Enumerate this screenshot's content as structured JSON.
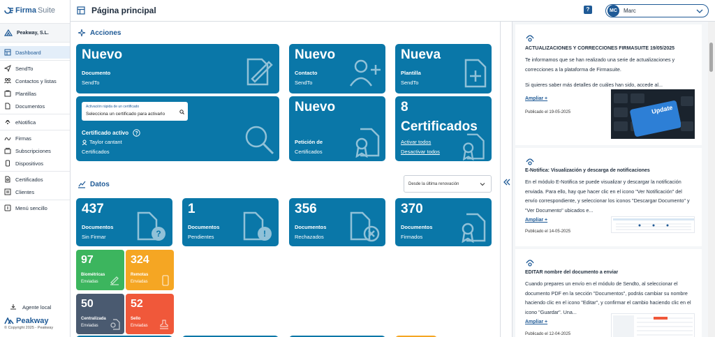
{
  "app": {
    "logo_a": "Firma",
    "logo_b": "Suite"
  },
  "sidebar": {
    "company": "Peakway, S.L.",
    "items": [
      {
        "label": "Dashboard",
        "icon": "dashboard-icon"
      },
      {
        "label": "SendTo",
        "icon": "send-icon"
      },
      {
        "label": "Contactos y listas",
        "icon": "contacts-icon"
      },
      {
        "label": "Plantillas",
        "icon": "templates-icon"
      },
      {
        "label": "Documentos",
        "icon": "documents-icon"
      },
      {
        "label": "eNotifica",
        "icon": "enotifica-icon"
      },
      {
        "label": "Firmas",
        "icon": "signature-icon"
      },
      {
        "label": "Subscripciones",
        "icon": "subscriptions-icon"
      },
      {
        "label": "Dispositivos",
        "icon": "device-icon"
      },
      {
        "label": "Certificados",
        "icon": "certificates-icon"
      },
      {
        "label": "Clientes",
        "icon": "clients-icon"
      },
      {
        "label": "Menú sencillo",
        "icon": "menu-icon"
      }
    ],
    "agent": "Agente local",
    "brand": "Peakway",
    "copyright": "© Copyright 2025 - Peakway"
  },
  "header": {
    "title": "Página principal",
    "help": "?",
    "user_initials": "MC",
    "user_name": "Marc"
  },
  "acciones": {
    "title": "Acciones",
    "cards": [
      {
        "big": "Nuevo",
        "l1": "Documento",
        "l2": "SendTo"
      },
      {
        "big": "Nuevo",
        "l1": "Contacto",
        "l2": "SendTo"
      },
      {
        "big": "Nueva",
        "l1": "Plantilla",
        "l2": "SendTo"
      }
    ],
    "cert": {
      "input_label": "Activación rápida de un certificado",
      "input_placeholder": "Selecciona un certificado para activarlo",
      "l1": "Certificado activo",
      "owner": "Taylor cantant",
      "l2": "Certificados"
    },
    "peticion": {
      "big": "Nuevo",
      "l1": "Petición de",
      "l2": "Certificados"
    },
    "certs": {
      "big1": "8",
      "big2": "Certificados",
      "activate": "Activar todos",
      "deactivate": "Desactivar todos"
    }
  },
  "datos": {
    "title": "Datos",
    "filter": "Desde la última renovación",
    "cards": [
      {
        "value": "437",
        "l1": "Documentos",
        "l2": "Sin Firmar"
      },
      {
        "value": "1",
        "l1": "Documentos",
        "l2": "Pendientes"
      },
      {
        "value": "356",
        "l1": "Documentos",
        "l2": "Rechazados"
      },
      {
        "value": "370",
        "l1": "Documentos",
        "l2": "Firmados"
      }
    ],
    "mini": [
      {
        "value": "97",
        "l1": "Biométricas",
        "l2": "Enviadas",
        "color": "#3cb55e"
      },
      {
        "value": "324",
        "l1": "Remotas",
        "l2": "Enviadas",
        "color": "#f5a623"
      },
      {
        "value": "50",
        "l1": "Centralizada",
        "l2": "Enviadas",
        "color": "#4a5a70"
      },
      {
        "value": "52",
        "l1": "Sello",
        "l2": "Enviadas",
        "color": "#f0583a"
      }
    ]
  },
  "news": [
    {
      "title": "ACTUALIZACIONES Y CORRECCIONES FIRMASUITE 19/05/2025",
      "body": "Te informamos que se han realizado una serie de actualizaciones y correcciones a la plataforma de Firmasuite.",
      "body2": "Si quieres saber más detalles de cuáles han sido, accede al...",
      "more": "Ampliar +",
      "date": "Publicado el 19-05-2025",
      "img_text": "Update"
    },
    {
      "title": "E-Notifica: Visualización y descarga de notificaciones",
      "body": "En el módulo E-Notifica se puede visualizar y descargar la notificación enviada. Para ello, hay que hacer clic en el icono \"Ver Notificación\" del envío correspondiente, y seleccionar los iconos \"Descargar Documento\" y \"Ver Documento\" ubicados e...",
      "more": "Ampliar +",
      "date": "Publicado el 14-05-2025"
    },
    {
      "title": "EDITAR nombre del documento a enviar",
      "body": "Cuando prepares un envío en el módulo de Sendto, al seleccionar el documento PDF en la sección \"Documentos\", podrás cambiar su nombre haciendo clic en el icono \"Editar\", y confirmar el cambio haciendo clic en el icono \"Guardar\". Una...",
      "more": "Ampliar +",
      "date": "Publicado el 12-04-2025"
    }
  ],
  "colors": {
    "brand": "#1f5a96",
    "card": "#0a77a8"
  }
}
